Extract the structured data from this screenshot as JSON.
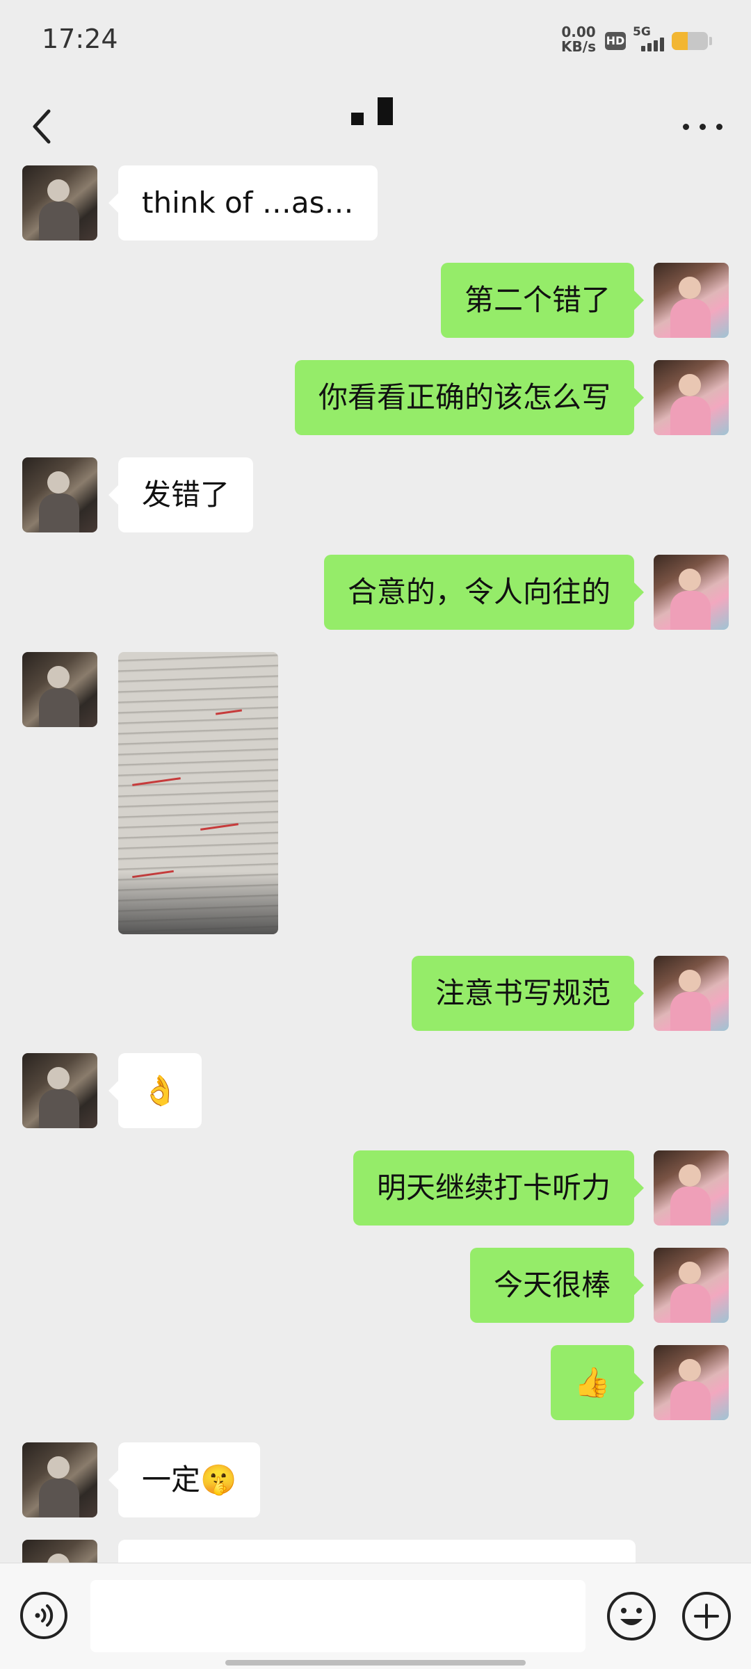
{
  "status_bar": {
    "time": "17:24",
    "net_speed_value": "0.00",
    "net_speed_unit": "KB/s",
    "hd_label": "HD",
    "signal_label": "5G",
    "battery_level": 0.45
  },
  "title_bar": {
    "title": ""
  },
  "messages": [
    {
      "side": "in",
      "text": "think of …as…"
    },
    {
      "side": "out",
      "text": "第二个错了"
    },
    {
      "side": "out",
      "text": "你看看正确的该怎么写"
    },
    {
      "side": "in",
      "text": "发错了"
    },
    {
      "side": "out",
      "text": "合意的，令人向往的"
    },
    {
      "side": "in",
      "type": "image"
    },
    {
      "side": "out",
      "text": "注意书写规范"
    },
    {
      "side": "in",
      "text": "👌"
    },
    {
      "side": "out",
      "text": "明天继续打卡听力"
    },
    {
      "side": "out",
      "text": "今天很棒"
    },
    {
      "side": "out",
      "text": "👍"
    },
    {
      "side": "in",
      "text": "一定🤫"
    },
    {
      "side": "in",
      "text": ""
    }
  ],
  "input_bar": {
    "placeholder": ""
  },
  "colors": {
    "background": "#ededed",
    "outgoing_bubble": "#95ec69",
    "incoming_bubble": "#ffffff",
    "battery": "#f2b632"
  },
  "icons": {
    "back": "back-icon",
    "more": "more-icon",
    "voice": "voice-icon",
    "emoji": "emoji-icon",
    "add": "add-icon"
  }
}
